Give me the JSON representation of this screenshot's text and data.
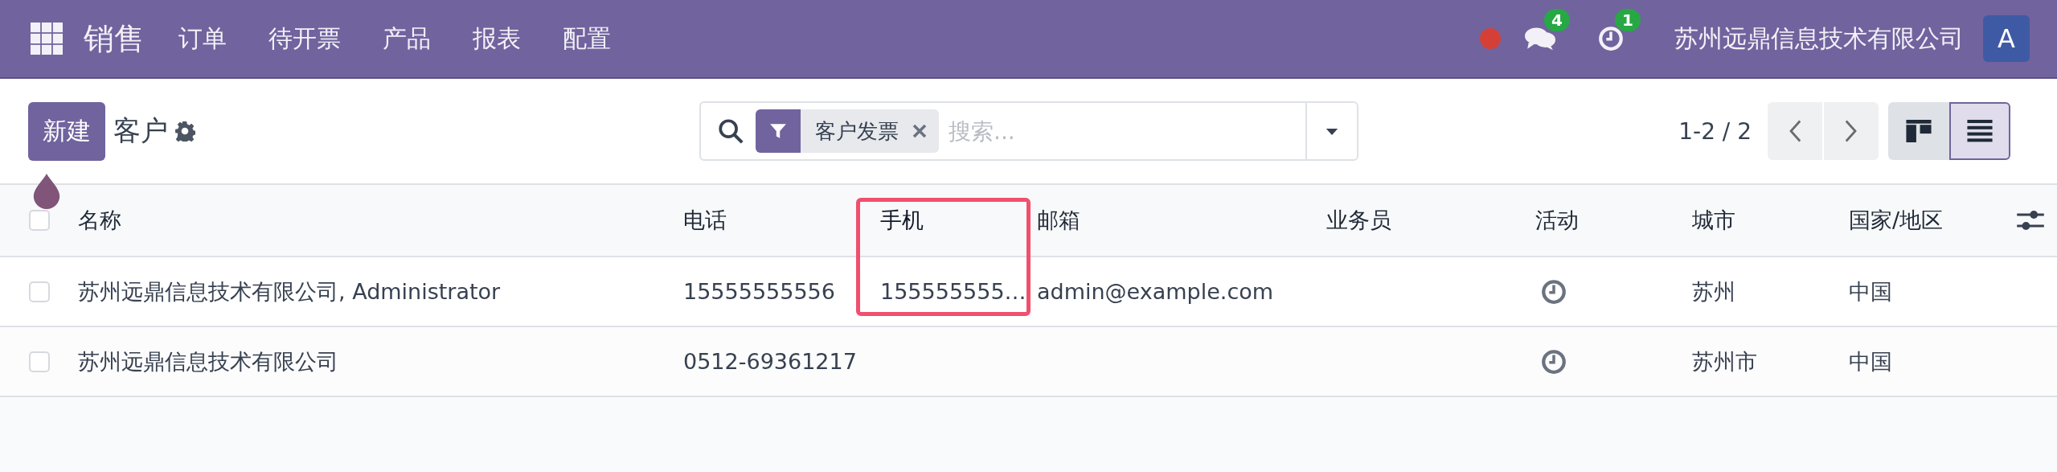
{
  "navbar": {
    "app": "销售",
    "menu": [
      "订单",
      "待开票",
      "产品",
      "报表",
      "配置"
    ],
    "systray": [
      {
        "kind": "status"
      },
      {
        "kind": "messages",
        "badge": "4"
      },
      {
        "kind": "activities",
        "badge": "1"
      }
    ],
    "company": "苏州远鼎信息技术有限公司",
    "avatar": "A"
  },
  "control_panel": {
    "new_button": "新建",
    "title": "客户",
    "search": {
      "facets": [
        {
          "label": "客户发票"
        }
      ],
      "placeholder": "搜索..."
    },
    "pager": "1-2 / 2",
    "views": [
      {
        "kind": "kanban",
        "selected": false
      },
      {
        "kind": "list",
        "selected": true
      }
    ]
  },
  "table": {
    "select_all": {
      "checked": false
    },
    "columns": [
      {
        "label": "名称",
        "highlighted": false
      },
      {
        "label": "电话",
        "highlighted": false
      },
      {
        "label": "手机",
        "highlighted": true
      },
      {
        "label": "邮箱",
        "highlighted": false
      },
      {
        "label": "业务员",
        "highlighted": false
      },
      {
        "label": "活动",
        "highlighted": false
      },
      {
        "label": "城市",
        "highlighted": false
      },
      {
        "label": "国家/地区",
        "highlighted": false
      }
    ],
    "rows": [
      {
        "selected": false,
        "cells": [
          "苏州远鼎信息技术有限公司, Administrator",
          "15555555556",
          "155555555…",
          "admin@example.com",
          null,
          {
            "kind": "activity"
          },
          "苏州",
          "中国"
        ]
      },
      {
        "selected": false,
        "cells": [
          "苏州远鼎信息技术有限公司",
          "0512-69361217",
          null,
          null,
          null,
          {
            "kind": "activity"
          },
          "苏州市",
          "中国"
        ]
      }
    ]
  }
}
